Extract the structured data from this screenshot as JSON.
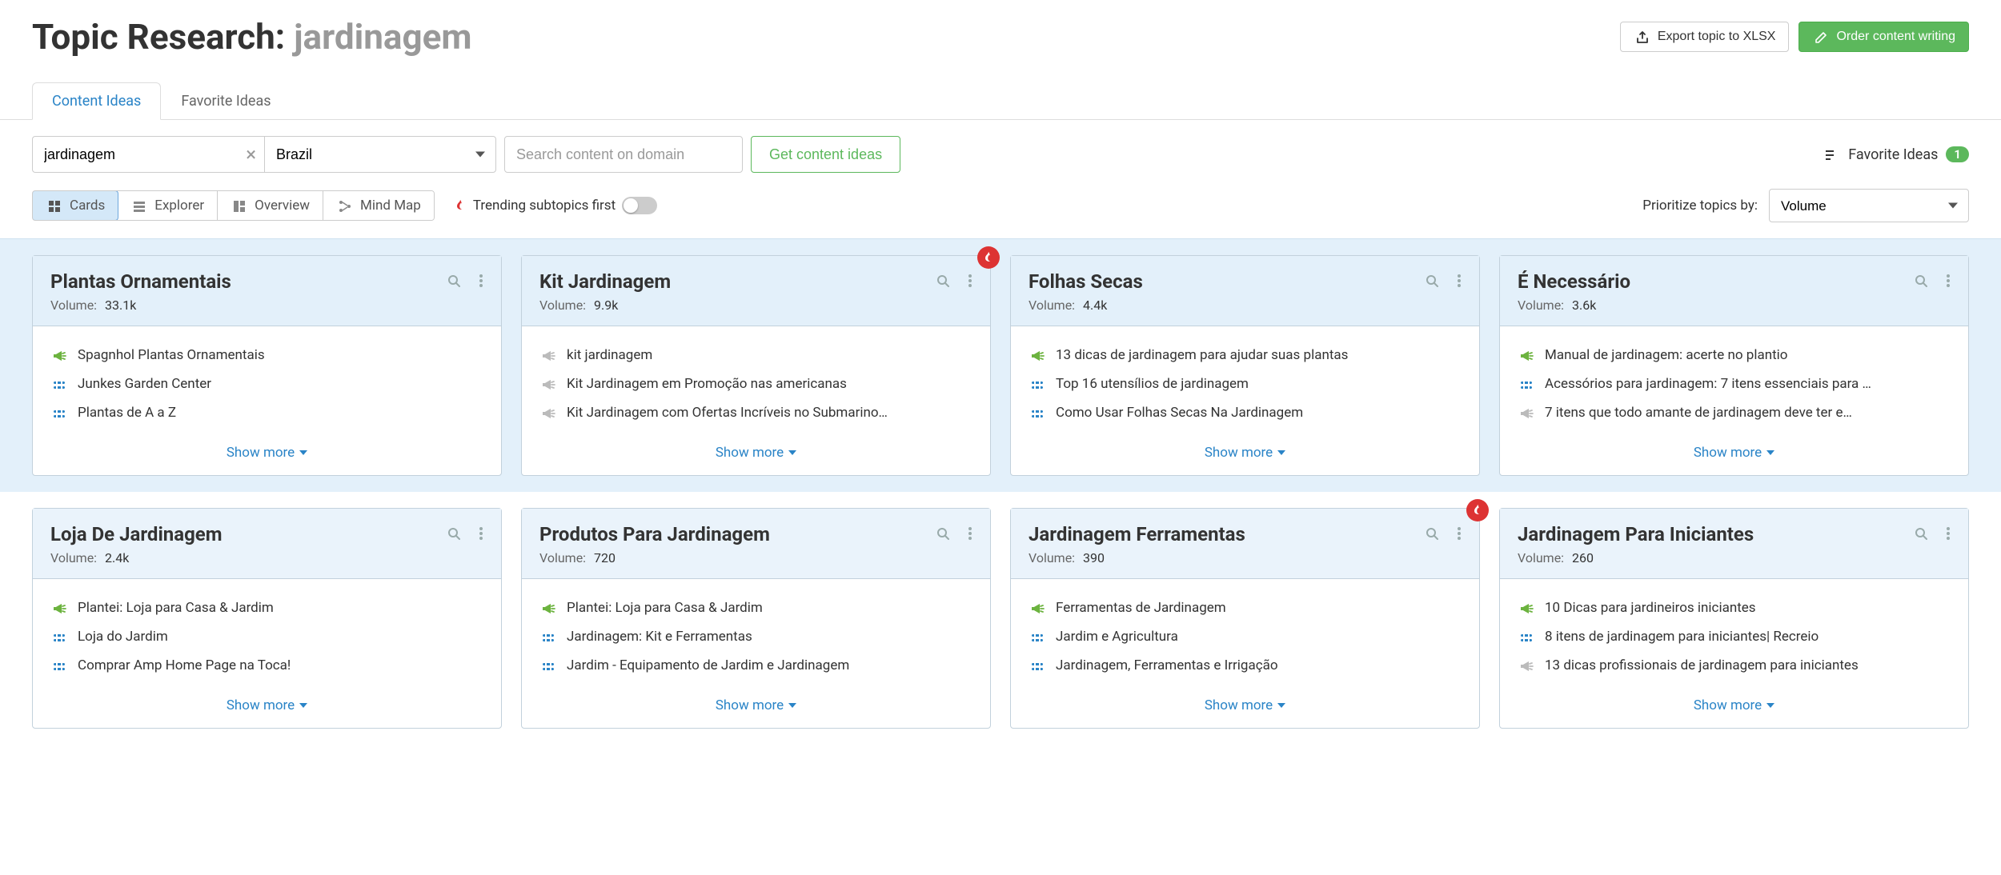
{
  "header": {
    "title_prefix": "Topic Research: ",
    "title_term": "jardinagem",
    "export_label": "Export topic to XLSX",
    "order_label": "Order content writing"
  },
  "tabs": {
    "content_ideas": "Content Ideas",
    "favorite_ideas": "Favorite Ideas"
  },
  "controls": {
    "topic_value": "jardinagem",
    "country_value": "Brazil",
    "domain_placeholder": "Search content on domain",
    "get_ideas_label": "Get content ideas",
    "favorite_ideas_label": "Favorite Ideas",
    "favorite_count": "1"
  },
  "views": {
    "cards": "Cards",
    "explorer": "Explorer",
    "overview": "Overview",
    "mindmap": "Mind Map",
    "trending_label": "Trending subtopics first",
    "prioritize_label": "Prioritize topics by:",
    "prioritize_value": "Volume"
  },
  "strings": {
    "volume_label": "Volume:",
    "show_more": "Show more"
  },
  "cards": [
    {
      "title": "Plantas Ornamentais",
      "volume": "33.1k",
      "trending": false,
      "items": [
        {
          "icon": "megaphone-green",
          "text": "Spagnhol Plantas Ornamentais"
        },
        {
          "icon": "link-blue",
          "text": "Junkes Garden Center"
        },
        {
          "icon": "link-blue",
          "text": "Plantas de A a Z"
        }
      ]
    },
    {
      "title": "Kit Jardinagem",
      "volume": "9.9k",
      "trending": true,
      "items": [
        {
          "icon": "megaphone-grey",
          "text": "kit jardinagem"
        },
        {
          "icon": "megaphone-grey",
          "text": "Kit Jardinagem em Promoção nas americanas"
        },
        {
          "icon": "megaphone-grey",
          "text": "Kit Jardinagem com Ofertas Incríveis no Submarino…"
        }
      ]
    },
    {
      "title": "Folhas Secas",
      "volume": "4.4k",
      "trending": false,
      "items": [
        {
          "icon": "megaphone-green",
          "text": "13 dicas de jardinagem para ajudar suas plantas"
        },
        {
          "icon": "link-blue",
          "text": "Top 16 utensílios de jardinagem"
        },
        {
          "icon": "link-blue",
          "text": "Como Usar Folhas Secas Na Jardinagem"
        }
      ]
    },
    {
      "title": "É Necessário",
      "volume": "3.6k",
      "trending": false,
      "items": [
        {
          "icon": "megaphone-green",
          "text": "Manual de jardinagem: acerte no plantio"
        },
        {
          "icon": "link-blue",
          "text": "Acessórios para jardinagem: 7 itens essenciais para …"
        },
        {
          "icon": "megaphone-grey",
          "text": "7 itens que todo amante de jardinagem deve ter e…"
        }
      ]
    },
    {
      "title": "Loja De Jardinagem",
      "volume": "2.4k",
      "trending": false,
      "items": [
        {
          "icon": "megaphone-green",
          "text": "Plantei: Loja para Casa & Jardim"
        },
        {
          "icon": "link-blue",
          "text": "Loja do Jardim"
        },
        {
          "icon": "link-blue",
          "text": "Comprar Amp Home Page na Toca!"
        }
      ]
    },
    {
      "title": "Produtos Para Jardinagem",
      "volume": "720",
      "trending": false,
      "items": [
        {
          "icon": "megaphone-green",
          "text": "Plantei: Loja para Casa & Jardim"
        },
        {
          "icon": "link-blue",
          "text": "Jardinagem: Kit e Ferramentas"
        },
        {
          "icon": "link-blue",
          "text": "Jardim - Equipamento de Jardim e Jardinagem"
        }
      ]
    },
    {
      "title": "Jardinagem Ferramentas",
      "volume": "390",
      "trending": true,
      "items": [
        {
          "icon": "megaphone-green",
          "text": "Ferramentas de Jardinagem"
        },
        {
          "icon": "link-blue",
          "text": "Jardim e Agricultura"
        },
        {
          "icon": "link-blue",
          "text": "Jardinagem, Ferramentas e Irrigação"
        }
      ]
    },
    {
      "title": "Jardinagem Para Iniciantes",
      "volume": "260",
      "trending": false,
      "items": [
        {
          "icon": "megaphone-green",
          "text": "10 Dicas para jardineiros iniciantes"
        },
        {
          "icon": "link-blue",
          "text": "8 itens de jardinagem para iniciantes| Recreio"
        },
        {
          "icon": "megaphone-grey",
          "text": "13 dicas profissionais de jardinagem para iniciantes"
        }
      ]
    }
  ]
}
